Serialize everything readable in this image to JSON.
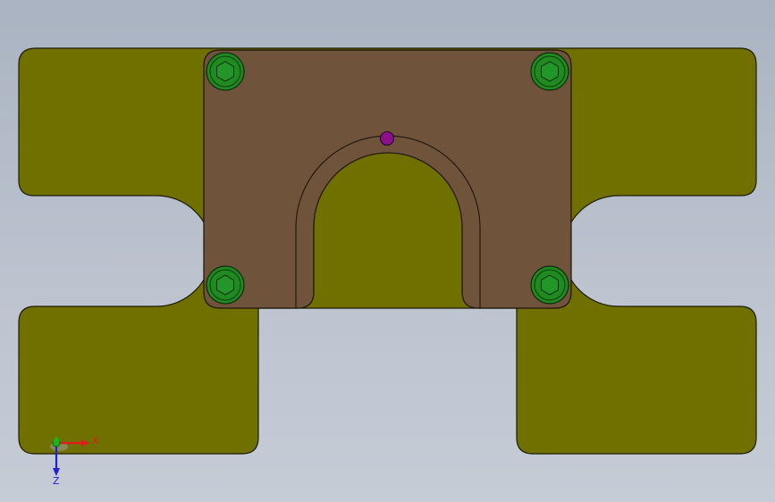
{
  "colors": {
    "background_top": "#aab3c1",
    "background_bottom": "#c6ccd6",
    "base_plate": "#707000",
    "clamp_plate": "#70533b",
    "screw": "#1f8a1f",
    "center_pin": "#8a118a",
    "x_axis": "#e11b1b",
    "y_axis": "#1fb21f",
    "z_axis": "#2020d8"
  },
  "triad": {
    "x_label": "X",
    "z_label": "Z"
  },
  "icons": {
    "screw": "hex-socket-screw-icon",
    "pin": "dowel-pin-icon",
    "triad": "coordinate-triad-icon"
  }
}
